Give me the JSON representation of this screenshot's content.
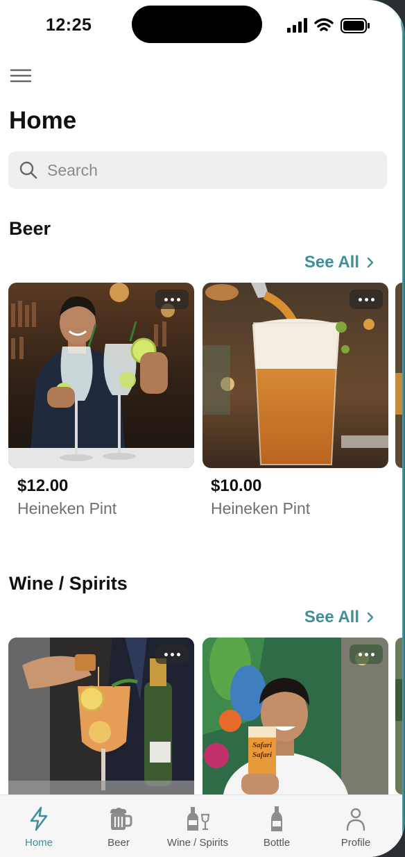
{
  "status_bar": {
    "time": "12:25",
    "icons": [
      "cellular-signal-icon",
      "wifi-icon",
      "battery-icon"
    ]
  },
  "header": {
    "menu_icon": "hamburger-menu-icon",
    "title": "Home"
  },
  "search": {
    "placeholder": "Search",
    "value": ""
  },
  "sections": [
    {
      "title": "Beer",
      "see_all": "See All",
      "items": [
        {
          "price": "$12.00",
          "name": "Heineken Pint",
          "image": "bartender-with-gin-cocktails"
        },
        {
          "price": "$10.00",
          "name": "Heineken Pint",
          "image": "beer-being-poured-into-pint"
        }
      ]
    },
    {
      "title": "Wine / Spirits",
      "see_all": "See All",
      "items": [
        {
          "image": "bartender-pouring-cocktail"
        },
        {
          "image": "smiling-man-holding-beer-glass"
        }
      ]
    }
  ],
  "tabs": [
    {
      "label": "Home",
      "icon": "lightning-bolt-icon",
      "active": true
    },
    {
      "label": "Beer",
      "icon": "beer-mug-icon",
      "active": false
    },
    {
      "label": "Wine / Spirits",
      "icon": "wine-bottle-glass-icon",
      "active": false
    },
    {
      "label": "Bottle",
      "icon": "bottle-icon",
      "active": false
    },
    {
      "label": "Profile",
      "icon": "person-icon",
      "active": false
    }
  ],
  "colors": {
    "accent": "#3f8e9c",
    "search_bg": "#efefef",
    "tabbar_bg": "#f6f6f6",
    "muted_text": "#6f6f6f"
  }
}
